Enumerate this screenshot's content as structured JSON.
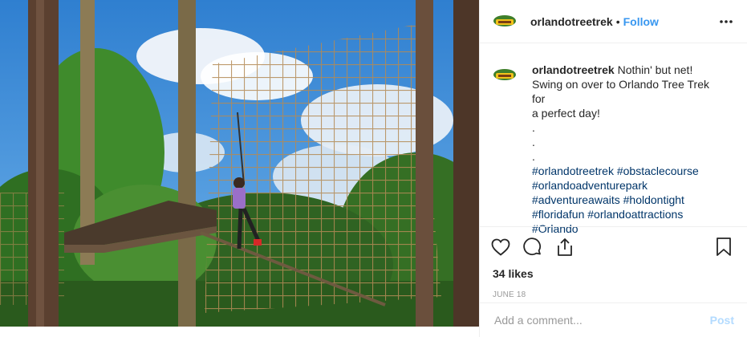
{
  "header": {
    "username": "orlandotreetrek",
    "separator": "•",
    "follow_label": "Follow",
    "more_icon": "more-options-icon"
  },
  "avatar": {
    "logo_text": "TREE TREK"
  },
  "caption": {
    "username": "orlandotreetrek",
    "lines": [
      "Nothin' but net!",
      "Swing on over to Orlando Tree Trek for",
      "a perfect day!",
      ".",
      ".",
      "."
    ],
    "hashtag_lines": [
      "#orlandotreetrek #obstaclecourse",
      "#orlandoadventurepark",
      "#adventureawaits #holdontight",
      "#floridafun #orlandoattractions",
      "#Orlando"
    ]
  },
  "actions": {
    "icons": [
      "heart-icon",
      "comment-icon",
      "share-icon",
      "bookmark-icon"
    ],
    "likes": "34 likes",
    "date": "JUNE 18"
  },
  "comment_box": {
    "placeholder": "Add a comment...",
    "post_label": "Post"
  },
  "colors": {
    "link_blue": "#3897f0",
    "hashtag": "#003569",
    "post_disabled": "#b3dbff",
    "border": "#efefef"
  }
}
